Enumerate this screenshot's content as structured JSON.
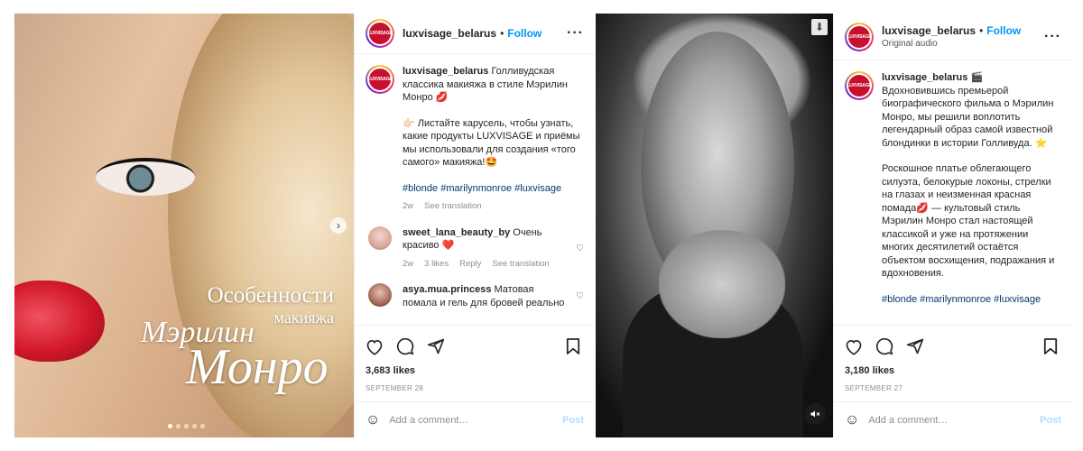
{
  "post1": {
    "overlay": {
      "line1": "Особенности",
      "line2": "макияжа",
      "line3": "Мэрилин",
      "line4": "Монро"
    },
    "carousel": {
      "slide_count": 5,
      "active_index": 0
    },
    "header": {
      "username": "luxvisage_belarus",
      "separator": "•",
      "follow": "Follow",
      "avatar_text": "LUXVISAGE"
    },
    "caption": {
      "username": "luxvisage_belarus",
      "text1": "Голливудская классика макияжа в стиле Мэрилин Монро 💋",
      "text2": "👉🏻 Листайте карусель, чтобы узнать, какие продукты LUXVISAGE и приёмы мы использовали для создания «того самого» макияжа!🤩",
      "hashtags": "#blonde #marilynmonroe #luxvisage",
      "time": "2w",
      "see_translation": "See translation"
    },
    "comments": [
      {
        "username": "sweet_lana_beauty_by",
        "text": "Очень красиво ❤️",
        "time": "2w",
        "likes": "3 likes",
        "reply": "Reply",
        "see_translation": "See translation"
      },
      {
        "username": "asya.mua.princess",
        "text": "Матовая помала и гель для бровей реально",
        "time": "",
        "likes": "",
        "reply": "",
        "see_translation": ""
      }
    ],
    "likes": "3,683 likes",
    "date": "SEPTEMBER 28",
    "add_comment": {
      "placeholder": "Add a comment…",
      "post": "Post"
    }
  },
  "post2": {
    "header": {
      "username": "luxvisage_belarus",
      "separator": "•",
      "follow": "Follow",
      "subline": "Original audio",
      "avatar_text": "LUXVISAGE"
    },
    "caption": {
      "username": "luxvisage_belarus",
      "emoji": "🎬",
      "text1": "Вдохновившись премьерой биографического фильма о Мэрилин Монро, мы решили воплотить легендарный образ самой известной блондинки в истории Голливуда. ⭐",
      "text2": "Роскошное платье облегающего силуэта, белокурые локоны, стрелки на глазах и неизменная красная помада💋 — культовый стиль Мэрилин Монро стал настоящей классикой и уже на протяжении многих десятилетий остаётся объектом восхищения, подражания и вдохновения.",
      "hashtags": "#blonde #marilynmonroe #luxvisage"
    },
    "likes": "3,180 likes",
    "date": "SEPTEMBER 27",
    "add_comment": {
      "placeholder": "Add a comment…",
      "post": "Post"
    }
  },
  "icons": {
    "heart": "heart-icon",
    "comment": "comment-icon",
    "share": "share-icon",
    "bookmark": "bookmark-icon",
    "emoji": "emoji-icon",
    "more": "more-icon",
    "next": "chevron-right-icon",
    "download": "download-icon",
    "mute": "mute-icon"
  },
  "colors": {
    "follow": "#0095f6",
    "brand_red": "#c8102e",
    "hashtag": "#00376b",
    "muted": "#8e8e8e"
  }
}
